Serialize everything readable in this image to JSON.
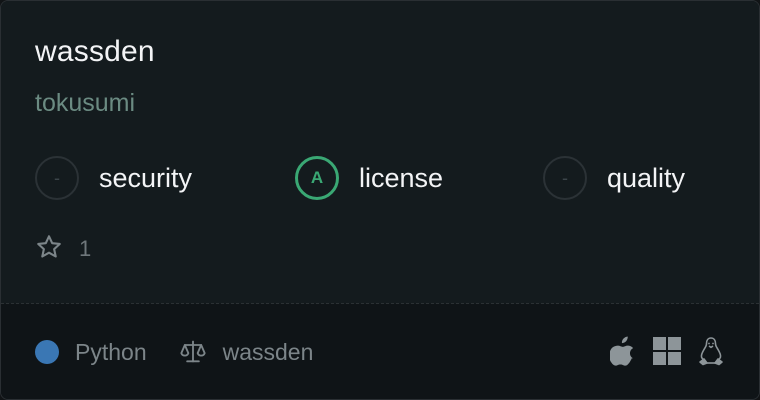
{
  "repo": {
    "name": "wassden",
    "owner": "tokusumi"
  },
  "metrics": [
    {
      "label": "security",
      "grade": "-",
      "state": "empty"
    },
    {
      "label": "license",
      "grade": "A",
      "state": "graded"
    },
    {
      "label": "quality",
      "grade": "-",
      "state": "empty"
    }
  ],
  "stars": {
    "count": "1",
    "icon": "star-icon"
  },
  "footer": {
    "language": "Python",
    "language_color": "#3a77b4",
    "license_name": "wassden",
    "license_icon": "scale-icon",
    "platforms": [
      "apple-icon",
      "windows-icon",
      "linux-icon"
    ]
  },
  "colors": {
    "grade_a": "#3aa874",
    "accent_owner": "#6b8b82"
  }
}
